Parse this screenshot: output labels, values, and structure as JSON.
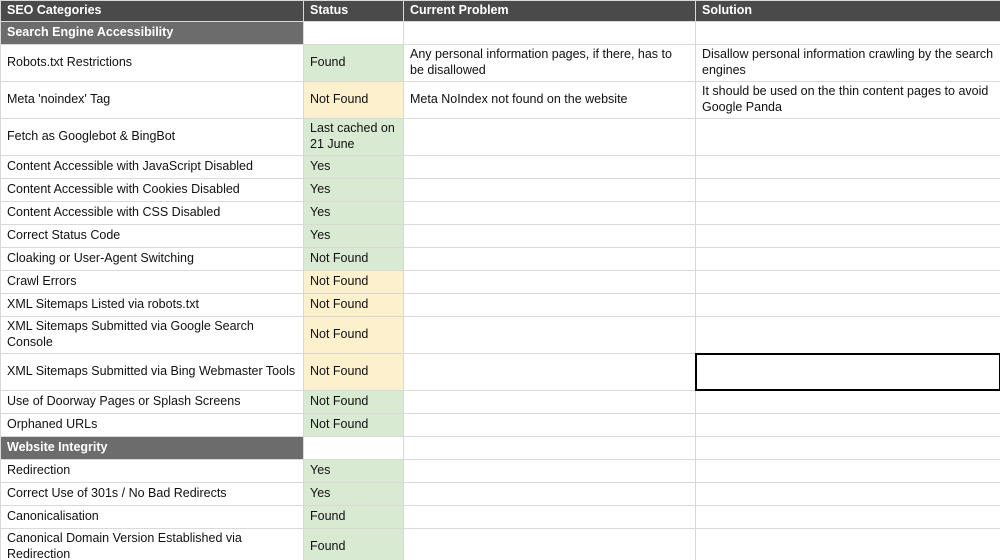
{
  "headers": {
    "c1": "SEO Categories",
    "c2": "Status",
    "c3": "Current Problem",
    "c4": "Solution"
  },
  "sections": {
    "sea": "Search Engine Accessibility",
    "wi": "Website Integrity"
  },
  "rows": {
    "robots": {
      "cat": "Robots.txt Restrictions",
      "status": "Found",
      "problem": "Any personal information pages, if there, has to be disallowed",
      "solution": "Disallow personal information crawling by the search engines"
    },
    "noindex": {
      "cat": "Meta 'noindex' Tag",
      "status": "Not Found",
      "problem": "Meta NoIndex not found on the website",
      "solution": "It should be used on the thin content pages to avoid Google Panda"
    },
    "fetch": {
      "cat": "Fetch as Googlebot & BingBot",
      "status": "Last cached on 21 June",
      "problem": "",
      "solution": ""
    },
    "js": {
      "cat": "Content Accessible with JavaScript Disabled",
      "status": "Yes",
      "problem": "",
      "solution": ""
    },
    "cookies": {
      "cat": "Content Accessible with Cookies Disabled",
      "status": "Yes",
      "problem": "",
      "solution": ""
    },
    "css": {
      "cat": "Content Accessible with CSS Disabled",
      "status": "Yes",
      "problem": "",
      "solution": ""
    },
    "statuscode": {
      "cat": "Correct Status Code",
      "status": "Yes",
      "problem": "",
      "solution": ""
    },
    "cloaking": {
      "cat": "Cloaking or User-Agent Switching",
      "status": "Not Found",
      "problem": "",
      "solution": ""
    },
    "crawl": {
      "cat": "Crawl Errors",
      "status": "Not Found",
      "problem": "",
      "solution": ""
    },
    "xmlrobots": {
      "cat": "XML Sitemaps Listed via robots.txt",
      "status": "Not Found",
      "problem": "",
      "solution": ""
    },
    "xmlgsc": {
      "cat": "XML Sitemaps Submitted via Google Search Console",
      "status": "Not Found",
      "problem": "",
      "solution": ""
    },
    "xmlbing": {
      "cat": "XML Sitemaps Submitted via Bing Webmaster Tools",
      "status": "Not Found",
      "problem": "",
      "solution": ""
    },
    "doorway": {
      "cat": "Use of Doorway Pages or Splash Screens",
      "status": "Not Found",
      "problem": "",
      "solution": ""
    },
    "orphan": {
      "cat": "Orphaned URLs",
      "status": "Not Found",
      "problem": "",
      "solution": ""
    },
    "redirect": {
      "cat": "Redirection",
      "status": "Yes",
      "problem": "",
      "solution": ""
    },
    "r301": {
      "cat": "Correct Use of 301s / No Bad Redirects",
      "status": "Yes",
      "problem": "",
      "solution": ""
    },
    "canon": {
      "cat": "Canonicalisation",
      "status": "Found",
      "problem": "",
      "solution": ""
    },
    "canondom": {
      "cat": "Canonical Domain Version Established via Redirection",
      "status": "Found",
      "problem": "",
      "solution": ""
    }
  }
}
